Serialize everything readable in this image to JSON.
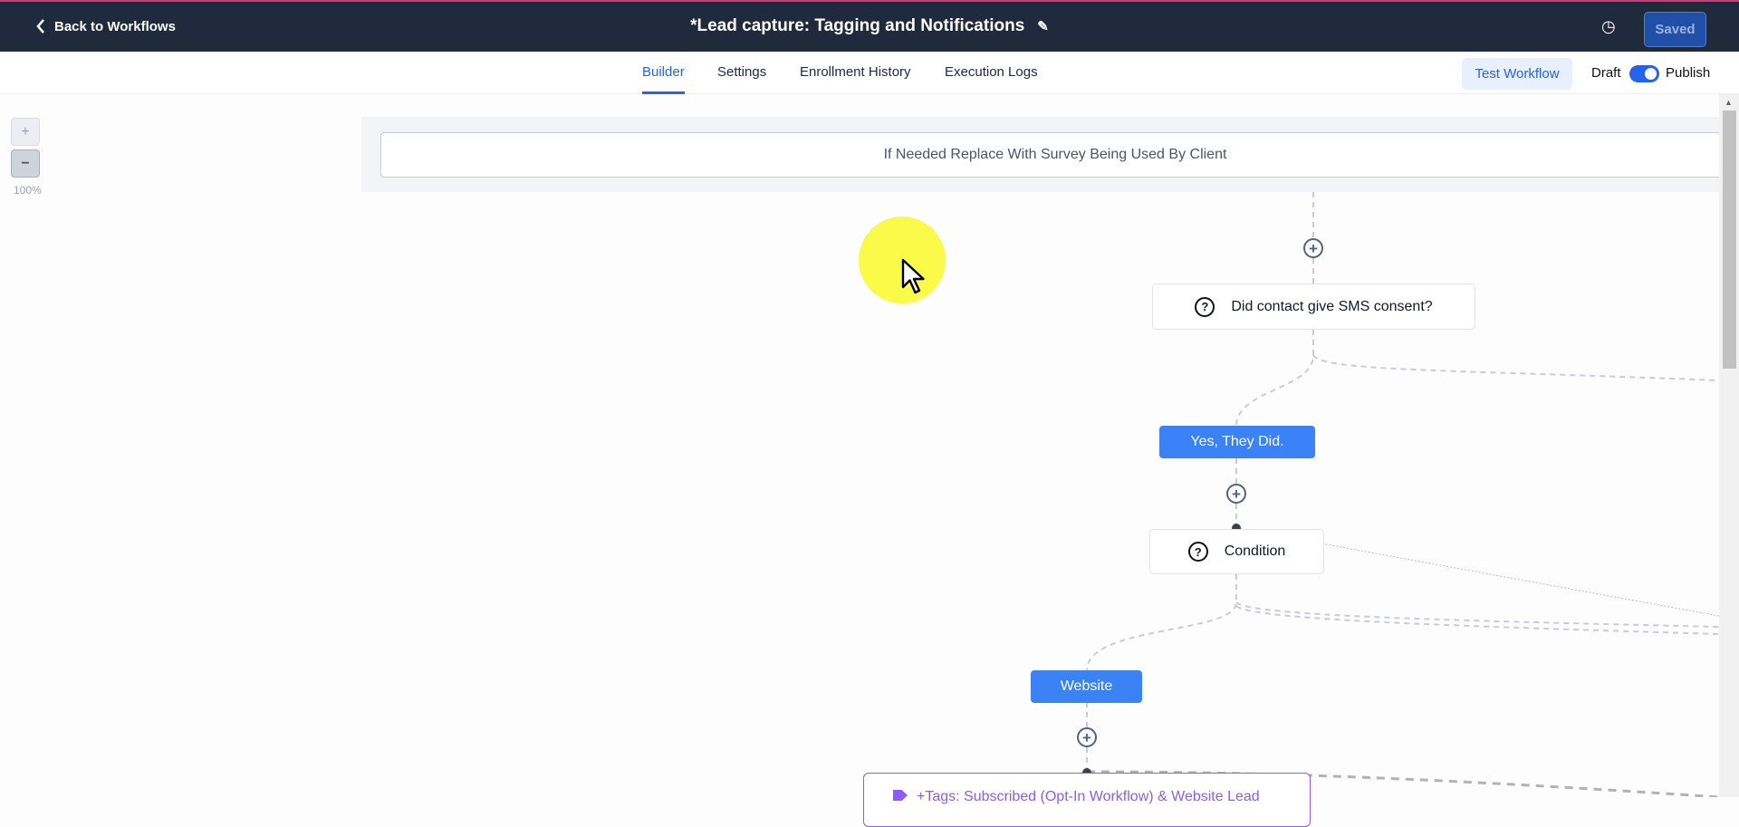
{
  "header": {
    "back_label": "Back to Workflows",
    "title": "*Lead capture: Tagging and Notifications",
    "saved_label": "Saved"
  },
  "tabs": [
    {
      "label": "Builder",
      "active": true
    },
    {
      "label": "Settings"
    },
    {
      "label": "Enrollment History"
    },
    {
      "label": "Execution Logs"
    }
  ],
  "actions": {
    "test_workflow": "Test Workflow",
    "draft": "Draft",
    "publish": "Publish",
    "published": true
  },
  "zoom": {
    "in": "+",
    "out": "−",
    "level": "100%"
  },
  "workflow": {
    "trigger": "If Needed Replace With Survey Being Used By Client",
    "sms_condition": "Did contact give SMS consent?",
    "yes_branch": "Yes, They Did.",
    "condition": "Condition",
    "website_branch": "Website",
    "tag_action": "+Tags: Subscribed (Opt-In Workflow) & Website Lead",
    "add_step": "+"
  },
  "colors": {
    "header_bg": "#1f2a3c",
    "accent": "#2563eb",
    "branch": "#3b82f6",
    "tag": "#8b5cf6"
  }
}
